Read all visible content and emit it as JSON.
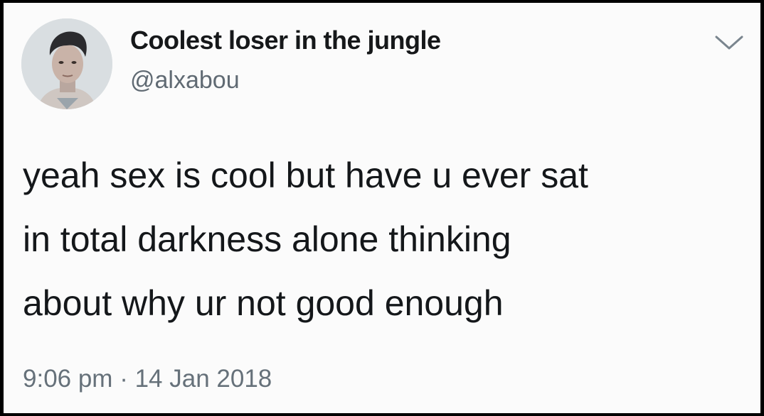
{
  "tweet": {
    "display_name": "Coolest loser in the jungle",
    "handle": "@alxabou",
    "text_lines": [
      "yeah sex is cool but have u ever sat",
      "in total darkness alone thinking",
      "about why ur not good enough"
    ],
    "time": "9:06 pm",
    "separator": "·",
    "date": "14 Jan 2018"
  },
  "icons": {
    "avatar": "profile-photo",
    "menu": "chevron-down-icon"
  },
  "colors": {
    "text": "#14171a",
    "secondary_text": "#66717a",
    "background": "#fbfbfb",
    "border": "#000000"
  }
}
